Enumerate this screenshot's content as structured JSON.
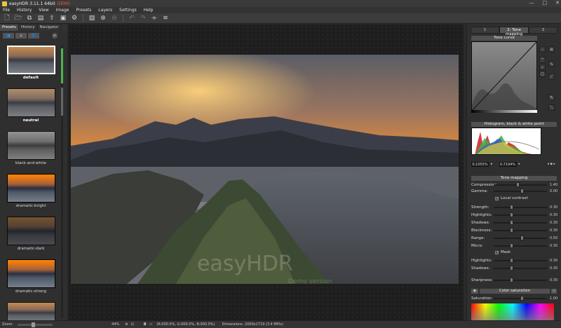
{
  "window": {
    "title": "easyHDR 3.11.1 64bit",
    "demo_label": "DEMO",
    "buttons": [
      "—",
      "□",
      "✕"
    ]
  },
  "menu": [
    "File",
    "History",
    "View",
    "Image",
    "Presets",
    "Layers",
    "Settings",
    "Help"
  ],
  "toolbar": {
    "icons": [
      "new-icon",
      "open-icon",
      "open-multi-icon",
      "save-icon",
      "export-icon",
      "save-as-icon",
      "settings-icon",
      "image-icon",
      "add-icon",
      "remove-icon",
      "undo-icon",
      "redo-icon",
      "crop-icon",
      "layers-icon"
    ]
  },
  "left_panel": {
    "tabs": [
      "Presets",
      "History",
      "Navigator"
    ],
    "presets": [
      {
        "label": "default",
        "style": "",
        "selected": true
      },
      {
        "label": "neutral",
        "style": "neutral",
        "bold": true
      },
      {
        "label": "black-and-white",
        "style": "bw"
      },
      {
        "label": "dramatic-bright",
        "style": "strong"
      },
      {
        "label": "dramatic-dark",
        "style": "dark"
      },
      {
        "label": "dramatic-strong",
        "style": "strong"
      },
      {
        "label": "",
        "style": ""
      }
    ]
  },
  "right_panel": {
    "tabs": [
      "1",
      "2: Tone mapping",
      "3"
    ],
    "tone_curve": {
      "title": "Tone curve"
    },
    "histogram": {
      "title": "Histogram, black & white point",
      "left_value": "0.1055%",
      "right_value": "0.7194%"
    },
    "tone_mapping": {
      "title": "Tone mapping",
      "sliders_top": [
        {
          "label": "Compression:",
          "value": "1.40",
          "pos": 0.42
        },
        {
          "label": "Gamma:",
          "value": "0.00",
          "pos": 0.5
        }
      ],
      "local_contrast": {
        "label": "Local contrast",
        "checked": true
      },
      "sliders_mid": [
        {
          "label": "Strength:",
          "value": "0.30",
          "pos": 0.3
        },
        {
          "label": "Highlights:",
          "value": "0.30",
          "pos": 0.3
        },
        {
          "label": "Shadows:",
          "value": "0.30",
          "pos": 0.3
        },
        {
          "label": "Blackness:",
          "value": "0.30",
          "pos": 0.3
        },
        {
          "label": "Range:",
          "value": "0.50",
          "pos": 0.5
        },
        {
          "label": "Micro:",
          "value": "0.30",
          "pos": 0.3
        }
      ],
      "mask": {
        "label": "Mask",
        "checked": true
      },
      "sliders_mask": [
        {
          "label": "Highlights:",
          "value": "0.30",
          "pos": 0.3
        },
        {
          "label": "Shadows:",
          "value": "0.30",
          "pos": 0.3
        }
      ],
      "sharpness": {
        "label": "Sharpness:",
        "value": "0.30",
        "pos": 0.3
      }
    },
    "color_saturation": {
      "title": "Color saturation",
      "label": "Saturation:",
      "value": "1.00",
      "pos": 0.5
    }
  },
  "status": {
    "zoom_label": "Zoom:",
    "zoom_value": "44%",
    "coords": "(R:000.0%, G:000.0%, B:000.0%)",
    "dimensions": "Dimensions: 2000x1719 (3.4 MPix)"
  },
  "watermark": {
    "brand": "easyHDR",
    "sub": "Demo version"
  }
}
